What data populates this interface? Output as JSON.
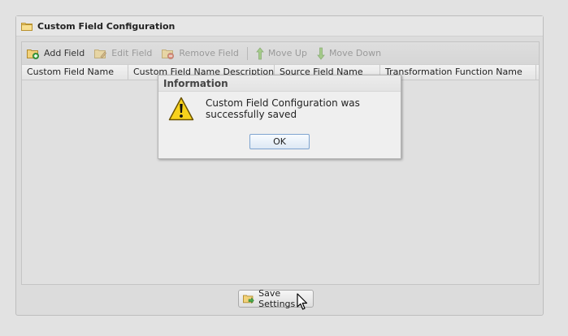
{
  "panel": {
    "title": "Custom Field Configuration",
    "icon": "folder-icon"
  },
  "toolbar": {
    "add_field": "Add Field",
    "edit_field": "Edit Field",
    "remove_field": "Remove Field",
    "move_up": "Move Up",
    "move_down": "Move Down"
  },
  "grid": {
    "columns": [
      "Custom Field Name",
      "Custom Field Name Description",
      "Source Field Name",
      "Transformation Function Name"
    ],
    "rows": []
  },
  "footer": {
    "save_settings": "Save Settings"
  },
  "dialog": {
    "title": "Information",
    "icon": "warning-icon",
    "message": "Custom Field Configuration was successfully saved",
    "ok_label": "OK"
  },
  "colors": {
    "accent_border": "#7ea4cf",
    "warning_yellow": "#f7d21c"
  }
}
